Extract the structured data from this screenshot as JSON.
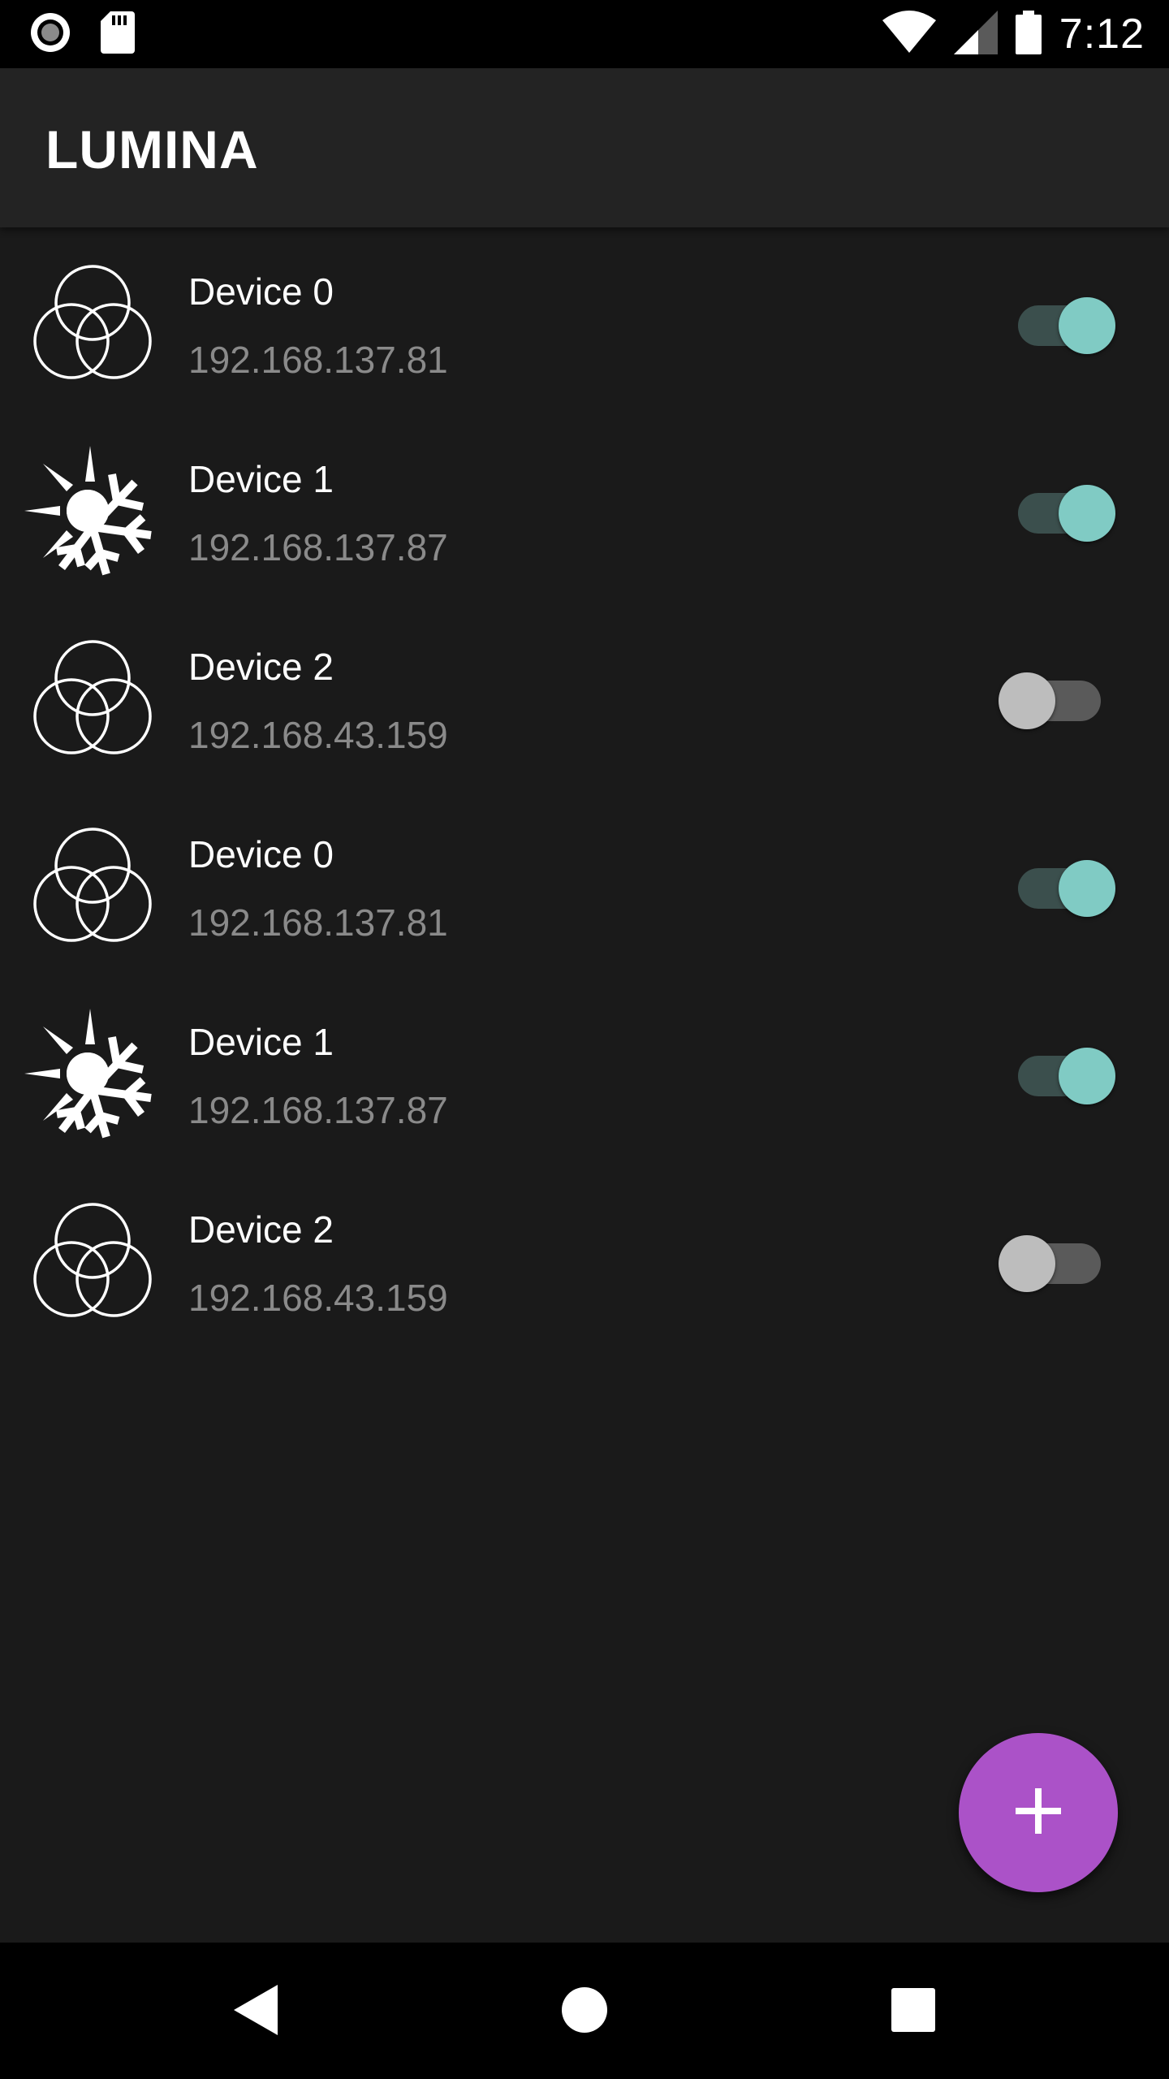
{
  "status_bar": {
    "time": "7:12",
    "left_icons": [
      "record-icon",
      "sd-card-icon"
    ],
    "right_icons": [
      "wifi-icon",
      "signal-icon",
      "battery-icon"
    ]
  },
  "app_bar": {
    "title": "LUMINA"
  },
  "devices": [
    {
      "name": "Device 0",
      "ip": "192.168.137.81",
      "icon": "rgb-circles-icon",
      "enabled": true
    },
    {
      "name": "Device 1",
      "ip": "192.168.137.87",
      "icon": "sun-snowflake-icon",
      "enabled": true
    },
    {
      "name": "Device 2",
      "ip": "192.168.43.159",
      "icon": "rgb-circles-icon",
      "enabled": false
    },
    {
      "name": "Device 0",
      "ip": "192.168.137.81",
      "icon": "rgb-circles-icon",
      "enabled": true
    },
    {
      "name": "Device 1",
      "ip": "192.168.137.87",
      "icon": "sun-snowflake-icon",
      "enabled": true
    },
    {
      "name": "Device 2",
      "ip": "192.168.43.159",
      "icon": "rgb-circles-icon",
      "enabled": false
    }
  ],
  "fab": {
    "icon": "plus-icon"
  },
  "nav_bar": {
    "icons": [
      "back-icon",
      "home-icon",
      "recents-icon"
    ]
  },
  "colors": {
    "background": "#1a1a1a",
    "app_bar": "#232323",
    "switch_on_thumb": "#80cbc4",
    "switch_on_track": "#3b4f4d",
    "switch_off_thumb": "#bdbdbd",
    "switch_off_track": "#5a5a5a",
    "fab": "#ab52c8",
    "secondary_text": "#8a8a8a"
  }
}
